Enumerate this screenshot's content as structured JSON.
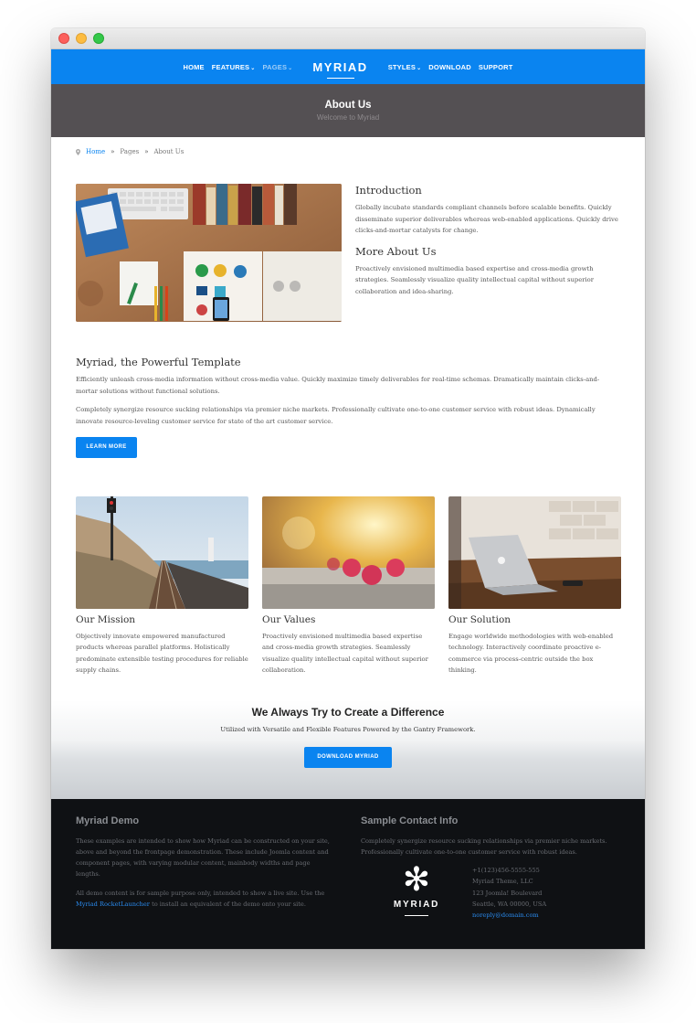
{
  "window": {
    "controls": [
      "close",
      "minimize",
      "zoom"
    ]
  },
  "nav": {
    "left": [
      {
        "label": "HOME",
        "has_caret": false
      },
      {
        "label": "FEATURES",
        "has_caret": true
      },
      {
        "label": "PAGES",
        "has_caret": true,
        "active": true
      }
    ],
    "logo": "MYRIAD",
    "right": [
      {
        "label": "STYLES",
        "has_caret": true
      },
      {
        "label": "DOWNLOAD",
        "has_caret": false
      },
      {
        "label": "SUPPORT",
        "has_caret": false
      }
    ],
    "caret_glyph": "⌄"
  },
  "header": {
    "title": "About Us",
    "subtitle": "Welcome to Myriad"
  },
  "breadcrumb": {
    "items": [
      "Home",
      "Pages",
      "About Us"
    ],
    "separator": "»"
  },
  "intro": {
    "image_icon": "desk-workspace-photo",
    "sections": [
      {
        "title": "Introduction",
        "text": "Globally incubate standards compliant channels before scalable benefits. Quickly disseminate superior deliverables whereas web-enabled applications. Quickly drive clicks-and-mortar catalysts for change."
      },
      {
        "title": "More About Us",
        "text": "Proactively envisioned multimedia based expertise and cross-media growth strategies. Seamlessly visualize quality intellectual capital without superior collaboration and idea-sharing."
      }
    ]
  },
  "powerful": {
    "title": "Myriad, the Powerful Template",
    "paragraphs": [
      "Efficiently unleash cross-media information without cross-media value. Quickly maximize timely deliverables for real-time schemas. Dramatically maintain clicks-and-mortar solutions without functional solutions.",
      "Completely synergize resource sucking relationships via premier niche markets. Professionally cultivate one-to-one customer service with robust ideas. Dynamically innovate resource-leveling customer service for state of the art customer service."
    ],
    "button": "LEARN MORE"
  },
  "cards": [
    {
      "title": "Our Mission",
      "image": "railway-coast-photo",
      "text": "Objectively innovate empowered manufactured products whereas parallel platforms. Holistically predominate extensible testing procedures for reliable supply chains."
    },
    {
      "title": "Our Values",
      "image": "raspberries-photo",
      "text": "Proactively envisioned multimedia based expertise and cross-media growth strategies. Seamlessly visualize quality intellectual capital without superior collaboration."
    },
    {
      "title": "Our Solution",
      "image": "laptop-desk-photo",
      "text": "Engage worldwide methodologies with web-enabled technology. Interactively coordinate proactive e-commerce via process-centric outside the box thinking."
    }
  ],
  "cta": {
    "title": "We Always Try to Create a Difference",
    "subtitle": "Utilized with Versatile and Flexible Features Powered by the Gantry Framework.",
    "button": "DOWNLOAD MYRIAD"
  },
  "footer": {
    "demo": {
      "title": "Myriad Demo",
      "p1": "These examples are intended to show how Myriad can be constructed on your site, above and beyond the frontpage demonstration. These include Joomla content and component pages, with varying modular content, mainbody widths and page lengths.",
      "p2_before": "All demo content is for sample purpose only, intended to show a live site. Use the ",
      "p2_link": "Myriad RocketLauncher",
      "p2_after": " to install an equivalent of the demo onto your site."
    },
    "contact": {
      "title": "Sample Contact Info",
      "text": "Completely synergize resource sucking relationships via premier niche markets. Professionally cultivate one-to-one customer service with robust ideas.",
      "logo_word": "MYRIAD",
      "logo_glyph": "✻",
      "phone": "+1(123)456-5555-555",
      "company": "Myriad Theme, LLC",
      "street": "123 Joomla! Boulevard",
      "city": "Seattle, WA 00000, USA",
      "email": "noreply@domain.com"
    }
  }
}
